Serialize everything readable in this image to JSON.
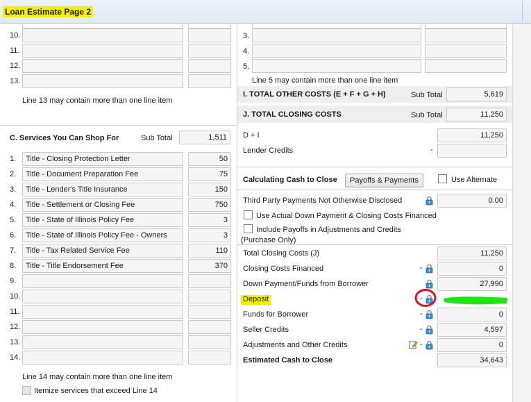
{
  "window": {
    "title": "Loan Estimate Page 2"
  },
  "left": {
    "top_rows": [
      {
        "num": "10."
      },
      {
        "num": "11."
      },
      {
        "num": "12."
      },
      {
        "num": "13."
      }
    ],
    "line13_note": "Line 13 may contain more than one line item",
    "section_c": {
      "title": "C. Services You Can Shop For",
      "subtotal_label": "Sub Total",
      "subtotal": "1,511",
      "rows": [
        {
          "num": "1.",
          "desc": "Title - Closing Protection Letter",
          "amount": "50"
        },
        {
          "num": "2.",
          "desc": "Title - Document Preparation Fee",
          "amount": "75"
        },
        {
          "num": "3.",
          "desc": "Title - Lender's Title Insurance",
          "amount": "150"
        },
        {
          "num": "4.",
          "desc": "Title - Settlement or Closing Fee",
          "amount": "750"
        },
        {
          "num": "5.",
          "desc": "Title - State of Illinois Policy Fee",
          "amount": "3"
        },
        {
          "num": "6.",
          "desc": "Title - State of Illinois Policy Fee - Owners",
          "amount": "3"
        },
        {
          "num": "7.",
          "desc": "Title - Tax Related Service Fee",
          "amount": "110"
        },
        {
          "num": "8.",
          "desc": "Title - Title Endorsement Fee",
          "amount": "370"
        },
        {
          "num": "9.",
          "desc": "",
          "amount": ""
        },
        {
          "num": "10.",
          "desc": "",
          "amount": ""
        },
        {
          "num": "11.",
          "desc": "",
          "amount": ""
        },
        {
          "num": "12.",
          "desc": "",
          "amount": ""
        },
        {
          "num": "13.",
          "desc": "",
          "amount": ""
        },
        {
          "num": "14.",
          "desc": "",
          "amount": ""
        }
      ],
      "line14_note": "Line 14 may contain more than one line item",
      "itemize_label": "Itemize services that exceed Line 14"
    }
  },
  "right": {
    "top_rows": [
      {
        "num": "3."
      },
      {
        "num": "4."
      },
      {
        "num": "5."
      }
    ],
    "line5_note": "Line 5 may contain more than one line item",
    "section_i": {
      "title": "I. TOTAL OTHER COSTS (E + F + G + H)",
      "subtotal_label": "Sub Total",
      "subtotal": "5,619"
    },
    "section_j": {
      "title": "J. TOTAL CLOSING COSTS",
      "subtotal_label": "Sub Total",
      "subtotal": "11,250"
    },
    "d_plus_i": {
      "label": "D + I",
      "value": "11,250"
    },
    "lender_credits": {
      "label": "Lender Credits",
      "prefix": "-",
      "value": ""
    },
    "cash_to_close": {
      "title": "Calculating Cash to Close",
      "payoffs_button": "Payoffs & Payments",
      "use_alternate": "Use Alternate",
      "third_party": {
        "label": "Third Party Payments Not Otherwise Disclosed",
        "value": "0.00"
      },
      "use_actual": "Use Actual Down Payment & Closing Costs Financed",
      "include_payoffs_line1": "Include Payoffs in Adjustments and Credits",
      "include_payoffs_line2": "(Purchase Only)",
      "rows": [
        {
          "label": "Total Closing Costs (J)",
          "prefix": "",
          "value": "11,250"
        },
        {
          "label": "Closing Costs Financed",
          "prefix": "-",
          "value": "0"
        },
        {
          "label": "Down Payment/Funds from Borrower",
          "prefix": "",
          "value": "27,990"
        },
        {
          "label": "Deposit",
          "prefix": "-",
          "value": ""
        },
        {
          "label": "Funds for Borrower",
          "prefix": "-",
          "value": "0"
        },
        {
          "label": "Seller Credits",
          "prefix": "-",
          "value": "4,597"
        },
        {
          "label": "Adjustments and Other Credits",
          "prefix": "-",
          "value": "0"
        }
      ],
      "estimated": {
        "label": "Estimated Cash to Close",
        "value": "34,643"
      }
    }
  },
  "colors": {
    "highlight_yellow": "#f4f000",
    "annotation_red": "#e0141e",
    "annotation_green": "#22e414"
  }
}
